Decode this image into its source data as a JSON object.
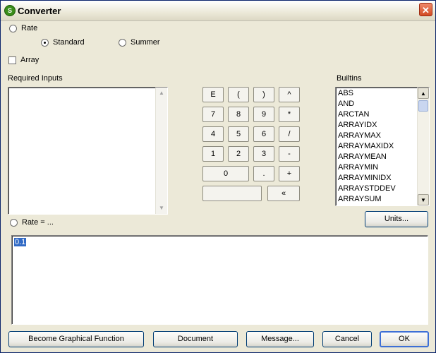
{
  "window": {
    "title": "Converter",
    "app_icon_letter": "S"
  },
  "rate_option": {
    "label": "Rate"
  },
  "sub_options": {
    "standard": "Standard",
    "summer": "Summer"
  },
  "array_checkbox": {
    "label": "Array"
  },
  "required_inputs": {
    "label": "Required Inputs"
  },
  "builtins": {
    "label": "Builtins",
    "items": [
      "ABS",
      "AND",
      "ARCTAN",
      "ARRAYIDX",
      "ARRAYMAX",
      "ARRAYMAXIDX",
      "ARRAYMEAN",
      "ARRAYMIN",
      "ARRAYMINIDX",
      "ARRAYSTDDEV",
      "ARRAYSUM"
    ]
  },
  "keypad": {
    "e": "E",
    "lparen": "(",
    "rparen": ")",
    "caret": "^",
    "seven": "7",
    "eight": "8",
    "nine": "9",
    "multiply": "*",
    "four": "4",
    "five": "5",
    "six": "6",
    "divide": "/",
    "one": "1",
    "two": "2",
    "three": "3",
    "minus": "-",
    "zero": "0",
    "dot": ".",
    "plus": "+",
    "blank": "",
    "backspace": "«"
  },
  "units_button": "Units...",
  "equation": {
    "label": "Rate = ...",
    "value": "0.1"
  },
  "footer": {
    "graphical": "Become Graphical Function",
    "document": "Document",
    "message": "Message...",
    "cancel": "Cancel",
    "ok": "OK"
  }
}
